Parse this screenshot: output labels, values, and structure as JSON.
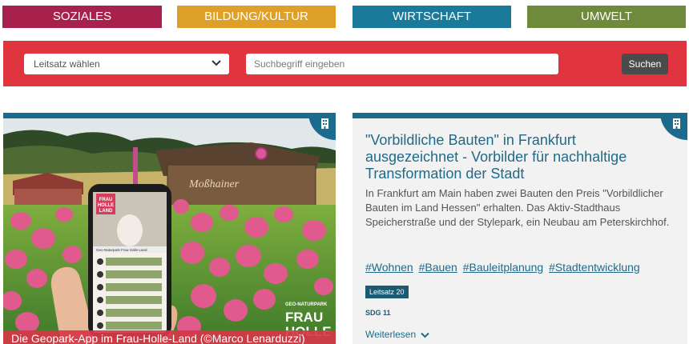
{
  "categories": [
    {
      "label": "SOZIALES",
      "color": "#a8214c"
    },
    {
      "label": "BILDUNG/KULTUR",
      "color": "#dfa02a"
    },
    {
      "label": "WIRTSCHAFT",
      "color": "#1b7a9a"
    },
    {
      "label": "UMWELT",
      "color": "#6e8a3a"
    }
  ],
  "search": {
    "select_label": "Leitsatz wählen",
    "input_placeholder": "Suchbegriff eingeben",
    "button_label": "Suchen"
  },
  "left_card": {
    "caption": "Die Geopark-App im Frau-Holle-Land (©Marco Lenarduzzi)",
    "icon": "building-icon",
    "photo_text": {
      "barn_sign": "Moßhainer",
      "logo_line1": "GEO-NATURPARK",
      "logo_line2": "FRAU",
      "logo_line3": "HOLLE",
      "phone_logo_1": "FRAU",
      "phone_logo_2": "HOLLE",
      "phone_logo_3": "LAND",
      "phone_header": "Geo-Naturpark Frau-Holle-Land"
    }
  },
  "right_card": {
    "title": "\"Vorbildliche Bauten\" in Frankfurt ausgezeichnet - Vorbilder für nachhaltige Transformation der Stadt",
    "description": "In Frankfurt am Main haben zwei Bauten den Preis \"Vorbildlicher Bauten im Land Hessen\" erhalten. Das Aktiv-Stadthaus Speicherstraße und der Stylepark, ein Neubau am Peterskirchhof.",
    "tags": [
      "#Wohnen",
      "#Bauen",
      "#Bauleitplanung",
      "#Stadtentwicklung"
    ],
    "leitsatz": "Leitsatz 20",
    "sdg": "SDG 11",
    "read_more": "Weiterlesen",
    "icon": "building-icon"
  }
}
